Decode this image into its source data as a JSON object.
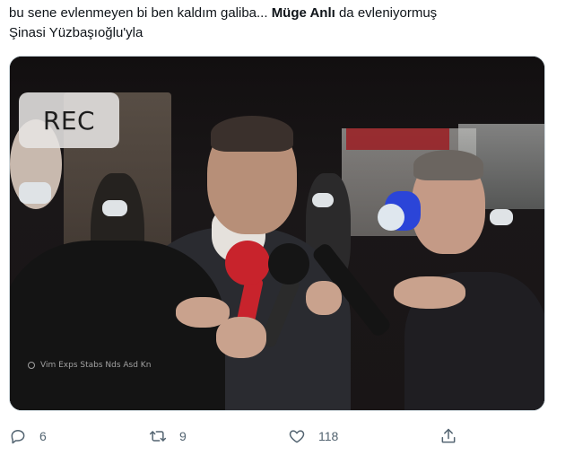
{
  "tweet": {
    "text_part1": "bu sene evlenmeyen bi ben kaldım galiba... ",
    "text_bold": "Müge Anlı",
    "text_part2": " da evleniyormuş",
    "text_line2": "Şinasi Yüzbaşıoğlu'yla"
  },
  "media": {
    "rec_label": "REC",
    "ticker_text": "Vim Exps Stabs Nds Asd Kn"
  },
  "actions": {
    "reply_count": "6",
    "retweet_count": "9",
    "like_count": "118",
    "icons": [
      "reply-icon",
      "retweet-icon",
      "like-icon",
      "share-icon"
    ]
  },
  "colors": {
    "text": "#0f1419",
    "secondary": "#536471",
    "border": "#cfd9de"
  }
}
